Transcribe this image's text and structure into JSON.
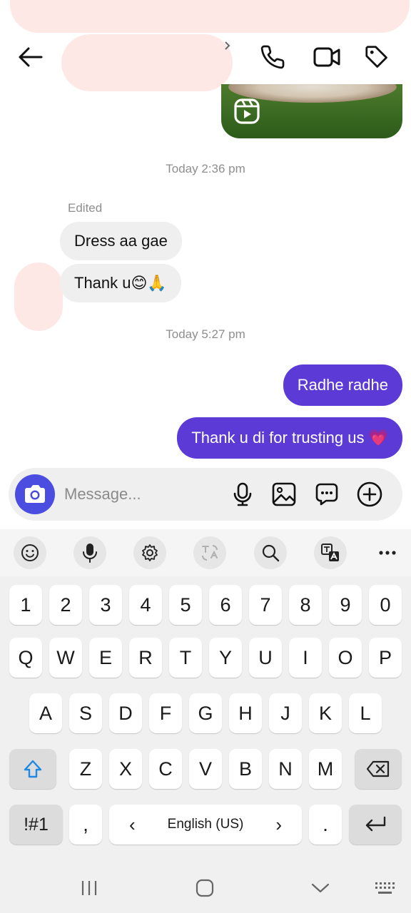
{
  "header": {
    "back_icon": "arrow-left-icon",
    "call_icon": "phone-icon",
    "video_icon": "video-camera-icon",
    "tag_icon": "tag-icon"
  },
  "conversation": {
    "reel_icon": "reels-icon",
    "timestamp_1": "Today 2:36 pm",
    "edited_label": "Edited",
    "incoming_1": "Dress aa gae",
    "incoming_2": "Thank u",
    "incoming_2_emoji": "😊🙏",
    "timestamp_2": "Today 5:27 pm",
    "outgoing_1": "Radhe radhe",
    "outgoing_2": "Thank u di for trusting us",
    "outgoing_2_emoji": "💗"
  },
  "composer": {
    "placeholder": "Message...",
    "icons": [
      "camera-icon",
      "microphone-icon",
      "gallery-icon",
      "sticker-icon",
      "plus-icon"
    ],
    "accent_color": "#4a4de0"
  },
  "keyboard": {
    "toolbar_icons": [
      "emoji-icon",
      "voice-input-icon",
      "settings-icon",
      "translate-icon",
      "search-icon",
      "text-translate-icon",
      "more-icon"
    ],
    "number_row": [
      "1",
      "2",
      "3",
      "4",
      "5",
      "6",
      "7",
      "8",
      "9",
      "0"
    ],
    "row1": [
      "Q",
      "W",
      "E",
      "R",
      "T",
      "Y",
      "U",
      "I",
      "O",
      "P"
    ],
    "row2": [
      "A",
      "S",
      "D",
      "F",
      "G",
      "H",
      "J",
      "K",
      "L"
    ],
    "row3": [
      "Z",
      "X",
      "C",
      "V",
      "B",
      "N",
      "M"
    ],
    "symbols_key": "!#1",
    "comma_key": ",",
    "space_label": "English (US)",
    "space_left_arrow": "‹",
    "space_right_arrow": "›",
    "period_key": ".",
    "shift_icon": "shift-icon",
    "backspace_icon": "backspace-icon",
    "enter_icon": "enter-icon"
  },
  "navbar": {
    "icons": [
      "recents-icon",
      "home-icon",
      "hide-keyboard-icon",
      "keyboard-switch-icon"
    ]
  },
  "colors": {
    "outgoing_bubble": "#5c3ad6",
    "incoming_bubble": "#efefef",
    "shift_active": "#1e88e5"
  }
}
